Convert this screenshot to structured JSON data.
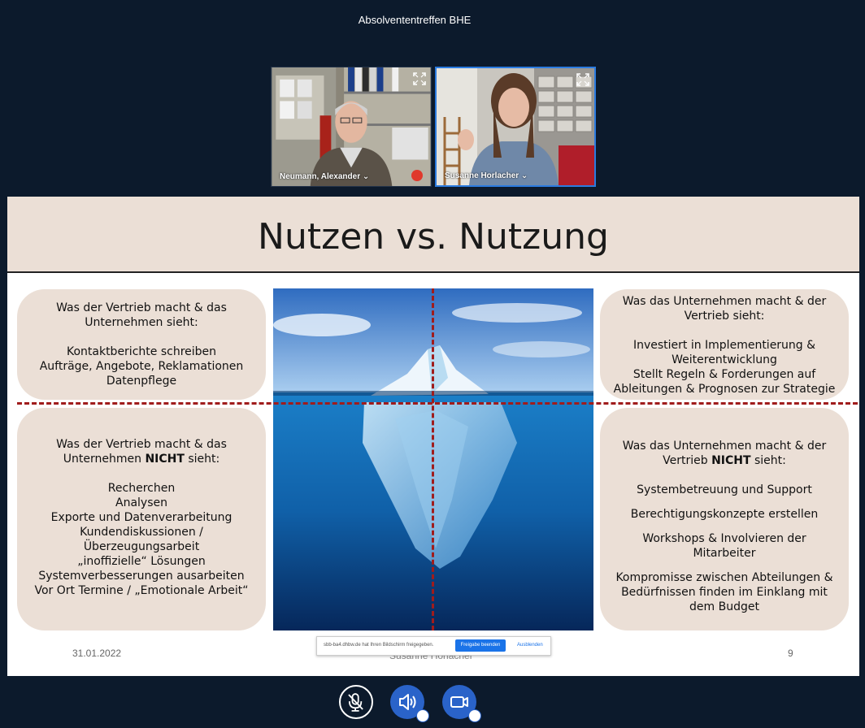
{
  "meeting": {
    "title": "Absolvententreffen BHE"
  },
  "participants": [
    {
      "name": "Neumann, Alexander ⌄",
      "muted": true
    },
    {
      "name": "Susanne Horlacher ⌄",
      "muted": false
    }
  ],
  "slide": {
    "title": "Nutzen vs. Nutzung",
    "top_left": {
      "heading1": "Was der Vertrieb macht & das",
      "heading2": "Unternehmen sieht:",
      "items": [
        "Kontaktberichte schreiben",
        "Aufträge, Angebote, Reklamationen",
        "Datenpflege"
      ]
    },
    "bottom_left": {
      "heading1": "Was der Vertrieb macht & das",
      "heading2_pre": "Unternehmen ",
      "heading2_bold": "NICHT",
      "heading2_post": " sieht:",
      "items": [
        "Recherchen",
        "Analysen",
        "Exporte und Datenverarbeitung",
        "Kundendiskussionen /",
        "Überzeugungsarbeit",
        "„inoffizielle“ Lösungen",
        "Systemverbesserungen ausarbeiten",
        "Vor Ort Termine / „Emotionale Arbeit“"
      ]
    },
    "top_right": {
      "heading1": "Was das Unternehmen macht & der",
      "heading2": "Vertrieb sieht:",
      "items": [
        "Investiert in Implementierung &",
        "Weiterentwicklung",
        "Stellt Regeln & Forderungen auf",
        "Ableitungen & Prognosen zur Strategie"
      ]
    },
    "bottom_right": {
      "heading1": "Was das Unternehmen macht & der",
      "heading2_pre": "Vertrieb ",
      "heading2_bold": "NICHT",
      "heading2_post": " sieht:",
      "items": [
        "Systembetreuung und Support",
        "Berechtigungskonzepte erstellen",
        "Workshops & Involvieren der Mitarbeiter",
        "Kompromisse zwischen Abteilungen &",
        "Bedürfnissen finden im Einklang mit",
        "dem Budget"
      ]
    },
    "footer": {
      "date": "31.01.2022",
      "author": "Susanne Horlacher",
      "page": "9"
    }
  },
  "share_notice": {
    "message": "sbb-ba4.dhbw.de hat Ihren Bildschirm freigegeben.",
    "stop_label": "Freigabe beenden",
    "hide_label": "Ausblenden"
  },
  "colors": {
    "accent": "#2a63c9",
    "slide_box": "#ebdfd6",
    "dash": "#a01c1c",
    "background": "#0c1a2c"
  }
}
